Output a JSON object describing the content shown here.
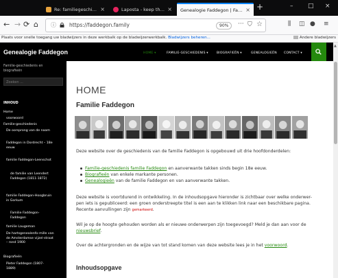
{
  "browser": {
    "tabs": [
      {
        "label": "Re: familiegeschiedenis - jelle...",
        "active": false,
        "favicon_color": "#e8a33d"
      },
      {
        "label": "Laposta - keep them posted",
        "active": false,
        "favicon_color": "#e5245e"
      },
      {
        "label": "Genealogie Faddegon | Familie-gesc...",
        "active": true,
        "favicon_color": "#9aa0a6"
      }
    ],
    "url": "https://faddegon.family",
    "zoom": "90%",
    "bookmarks_message": "Plaats voor snelle toegang uw bladwijzers in deze werkbalk op de bladwijzerwerkbalk.",
    "bookmarks_link": "Bladwijzers beheren...",
    "other_bookmarks": "Andere bladwijzers"
  },
  "site": {
    "title": "Genealogie Faddegon",
    "menu": [
      "HOME ▾",
      "FAMILIE-GESCHIEDENIS ▾",
      "BIOGRAFIEËN ▾",
      "GENEALOGIEËN",
      "CONTACT ▾"
    ],
    "accent": "#24890d"
  },
  "sidebar": {
    "tagline": "Familie-geschiedenis en biografieën",
    "search_placeholder": "Zoeken ...",
    "heading": "INHOUD",
    "items": [
      "Home",
      "voorwoord",
      "Familie-geschiedenis",
      "De oorsprong van de naam",
      "Faddegon in Dordrecht – 18e eeuw",
      "familie Faddegon-Leenschot",
      "de familie van Leendert Faddegon (1811-1872)",
      "familie Faddegon-Hoogbruin in Gorkum",
      "Familie Faddegon-Faddegon",
      "familie Laugeman",
      "De hartsgenealenfo-mille van de Amsterdamse vijzel-straat – rond 1900",
      "Biografieën",
      "Pieter Faddegon (1807-1889)"
    ]
  },
  "main": {
    "page_title": "HOME",
    "family_title": "Familie Faddegon",
    "intro": "Deze website over de geschiedenis van de familie Faddegon is opgebouwd uit drie hoofdonderdelen:",
    "bullets": [
      {
        "link": "Familie-geschiedenis familie Faddegon",
        "text": " en aanverwante takken sinds begin 18e eeuw."
      },
      {
        "link": "Biografieën",
        "text": " van enkele markante personen."
      },
      {
        "link": "Genealogieën",
        "text": " van de familie Faddegon en van aanverwante takken."
      }
    ],
    "p2_text": "Deze website is voortdurend in ontwikkeling. In de inhoudsopgave hieronder is zichtbaar over welke onderwer-pen iets is gepubliceerd: een groen onderstreepte titel is een aan te klikken link naar een beschikbare pagina. Recente aanvullingen zijn ",
    "p2_red": "gemarkeerd",
    "p3_text": "Wil je op de hoogte gehouden worden als er nieuwe onderwerpen zijn toegevoegd? Meld je dan aan voor de ",
    "p3_link": "nieuwsbrief",
    "p4_text": "Over de achtergronden en de wijze van tot stand komen van deze website lees je in het ",
    "p4_link": "voorwoord",
    "toc_title": "Inhoudsopgave"
  }
}
